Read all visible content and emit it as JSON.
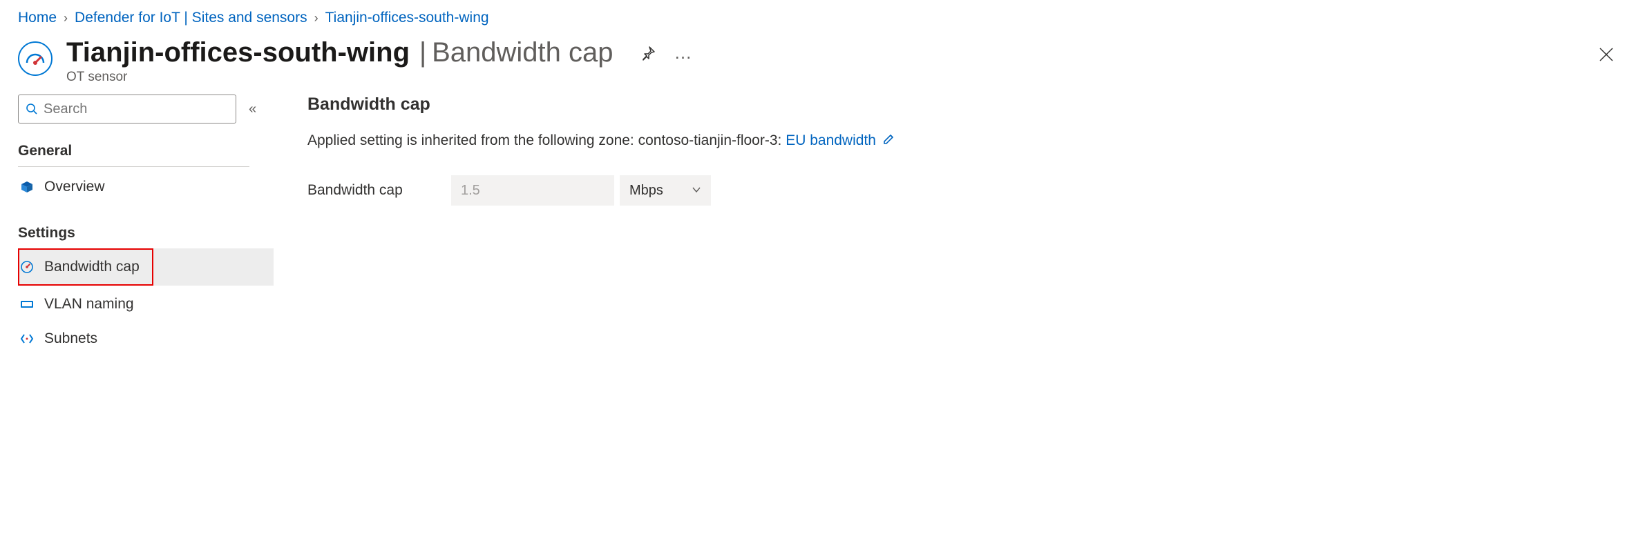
{
  "breadcrumb": {
    "items": [
      {
        "label": "Home"
      },
      {
        "label": "Defender for IoT | Sites and sensors"
      },
      {
        "label": "Tianjin-offices-south-wing"
      }
    ]
  },
  "header": {
    "title_main": "Tianjin-offices-south-wing",
    "title_separator": "|",
    "title_sub": "Bandwidth cap",
    "subtitle": "OT sensor"
  },
  "sidebar": {
    "search_placeholder": "Search",
    "sections": [
      {
        "label": "General",
        "items": [
          {
            "label": "Overview",
            "icon": "cube-icon"
          }
        ]
      },
      {
        "label": "Settings",
        "items": [
          {
            "label": "Bandwidth cap",
            "icon": "gauge-icon",
            "selected": true,
            "highlighted": true
          },
          {
            "label": "VLAN naming",
            "icon": "tag-icon"
          },
          {
            "label": "Subnets",
            "icon": "brackets-icon"
          }
        ]
      }
    ]
  },
  "main": {
    "heading": "Bandwidth cap",
    "desc_prefix": "Applied setting is inherited from the following zone: contoso-tianjin-floor-3: ",
    "desc_link": "EU bandwidth",
    "field": {
      "label": "Bandwidth cap",
      "value": "1.5",
      "unit": "Mbps"
    }
  }
}
